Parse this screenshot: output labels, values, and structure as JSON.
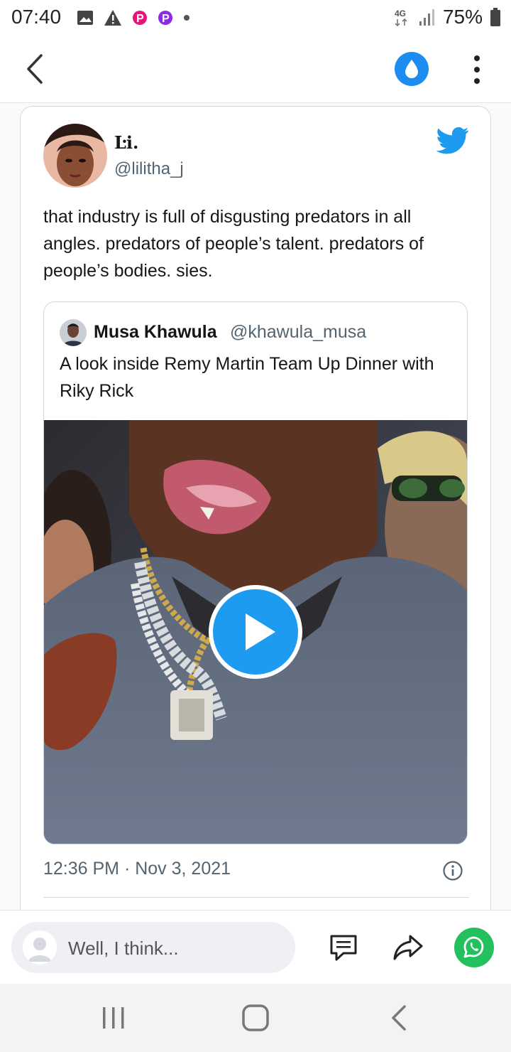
{
  "status_bar": {
    "time": "07:40",
    "network": "4G",
    "battery": "75%",
    "notification_icons": [
      "gallery-icon",
      "warning-icon",
      "p-app-icon",
      "p-app-icon",
      "dot-icon"
    ]
  },
  "toolbar": {
    "back_icon": "chevron-left-icon",
    "action_icon": "water-drop-icon",
    "menu_icon": "more-vertical-icon",
    "accent": "#1d8cf0"
  },
  "tweet": {
    "author_name": "Ŀi.",
    "author_handle": "@lilitha_j",
    "text": "that industry is full of disgusting predators in all angles. predators of people’s talent. predators of people’s bodies. sies.",
    "timestamp": "12:36 PM · Nov 3, 2021",
    "brand_color": "#1d9bf0",
    "quoted": {
      "author_name": "Musa Khawula",
      "author_handle": "@khawula_musa",
      "text": "A look inside Remy Martin Team Up Dinner with Riky Rick",
      "media_icon": "play-icon"
    }
  },
  "bottom_bar": {
    "comment_placeholder": "Well, I think...",
    "whatsapp_color": "#22c15e"
  }
}
